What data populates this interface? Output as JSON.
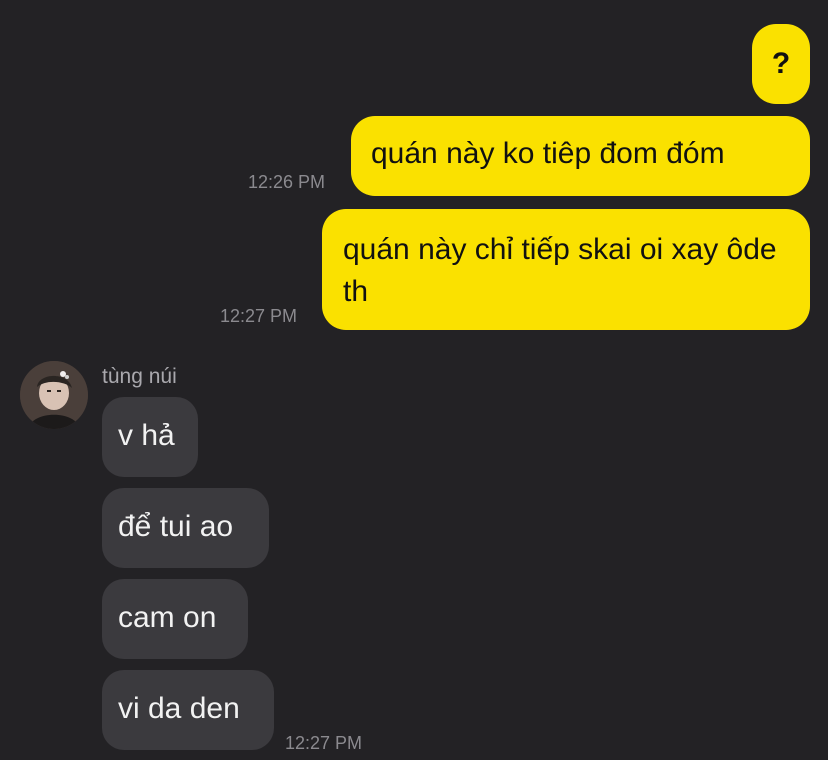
{
  "outgoing": [
    {
      "text": "?",
      "time": ""
    },
    {
      "text": "quán này ko tiêp đom đóm",
      "time": "12:26 PM"
    },
    {
      "text": "quán này chỉ tiếp skai oi xay ôde th",
      "time": "12:27 PM"
    }
  ],
  "incoming": {
    "sender": "tùng núi",
    "messages": [
      "v hả",
      "để tui ao",
      "cam on",
      "vi da den"
    ],
    "time": "12:27 PM"
  },
  "colors": {
    "background": "#232225",
    "outgoing_bubble": "#fae100",
    "incoming_bubble": "#3b3a3e",
    "timestamp": "#8b8a8f"
  }
}
